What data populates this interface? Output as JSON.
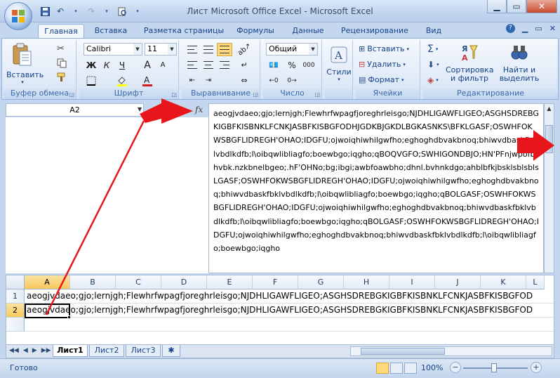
{
  "window": {
    "title": "Лист Microsoft Office Excel - Microsoft Excel"
  },
  "ribbon": {
    "tabs": [
      "Главная",
      "Вставка",
      "Разметка страницы",
      "Формулы",
      "Данные",
      "Рецензирование",
      "Вид"
    ],
    "groups": {
      "clipboard": {
        "label": "Буфер обмена",
        "paste": "Вставить"
      },
      "font": {
        "label": "Шрифт",
        "font_name": "Calibri",
        "font_size": "11",
        "bold": "Ж",
        "italic": "К",
        "underline": "Ч",
        "grow": "A",
        "shrink": "A"
      },
      "alignment": {
        "label": "Выравнивание"
      },
      "number": {
        "label": "Число",
        "format": "Общий",
        "percent": "%",
        "thousands": "000"
      },
      "styles": {
        "label": "",
        "styles_btn": "Стили"
      },
      "cells": {
        "label": "Ячейки",
        "insert": "Вставить",
        "delete": "Удалить",
        "format": "Формат"
      },
      "editing": {
        "label": "Редактирование",
        "sort_filter": "Сортировка и фильтр",
        "find_select": "Найти и выделить",
        "sigma": "Σ"
      }
    }
  },
  "formula_bar": {
    "name_box": "A2",
    "fx": "fx",
    "content": "aeogjvdaeo;gjo;lernjgh;Flewhrfwpagfjoreghrleisgo;NJDHLIGAWFLIGEO;ASGHSDREBGKIGBFKISBNKLFCNKJASBFKISBGFODHJGDKBJGKDLBGKASNKS\\BFKLGASF;OSWHFOKWSBGFLIDREGH'OHAO;IDGFU;ojwoiqhiwhilgwfho;eghoghdbvakbnoq;bhiwvdbaskfbklvbdlkdfb;l\\oibqwlibliagfo;boewbgo;iqgho;qBOQVGFO;SWHIGONDBJO;HN'PFnjwpofbhvbk.nzkbnelbgeo;.hF'OHNo;bg;ibgi;awbfoawbho;dhnl.bvhnkdgo;ahblbfkjbsklsblsblsLGASF;OSWHFOKWSBGFLIDREGH'OHAO;IDGFU;ojwoiqhiwhilgwfho;eghoghdbvakbnoq;bhiwvdbaskfbklvbdlkdfb;l\\oibqwlibliagfo;boewbgo;iqgho;qBOLGASF;OSWHFOKWSBGFLIDREGH'OHAO;IDGFU;ojwoiqhiwhilgwfho;eghoghdbvakbnoq;bhiwvdbaskfbklvbdlkdfb;l\\oibqwlibliagfo;boewbgo;iqgho;qBOLGASF;OSWHFOKWSBGFLIDREGH'OHAO;IDGFU;ojwoiqhiwhilgwfho;eghoghdbvakbnoq;bhiwvdbaskfbklvbdlkdfb;l\\oibqwlibliagfo;boewbgo;iqgho"
  },
  "grid": {
    "columns": [
      "A",
      "B",
      "C",
      "D",
      "E",
      "F",
      "G",
      "H",
      "I",
      "J",
      "K",
      "L"
    ],
    "selected_column": "A",
    "rows": [
      {
        "num": "1",
        "text": "aeogjvdaeo;gjo;lernjgh;Flewhrfwpagfjoreghrleisgo;NJDHLIGAWFLIGEO;ASGHSDREBGKIGBFKISBNKLFCNKJASBFKISBGFOD"
      },
      {
        "num": "2",
        "text": "aeogjvdaeo;gjo;lernjgh;Flewhrfwpagfjoreghrleisgo;NJDHLIGAWFLIGEO;ASGHSDREBGKIGBFKISBNKLFCNKJASBFKISBGFOD"
      }
    ],
    "active_cell": "A2"
  },
  "sheets": {
    "tabs": [
      "Лист1",
      "Лист2",
      "Лист3"
    ],
    "active": "Лист1"
  },
  "status": {
    "text": "Готово",
    "zoom": "100%",
    "minus": "−",
    "plus": "+"
  },
  "colors": {
    "annotation_arrow": "#e8151b",
    "ribbon_text": "#15428b"
  }
}
